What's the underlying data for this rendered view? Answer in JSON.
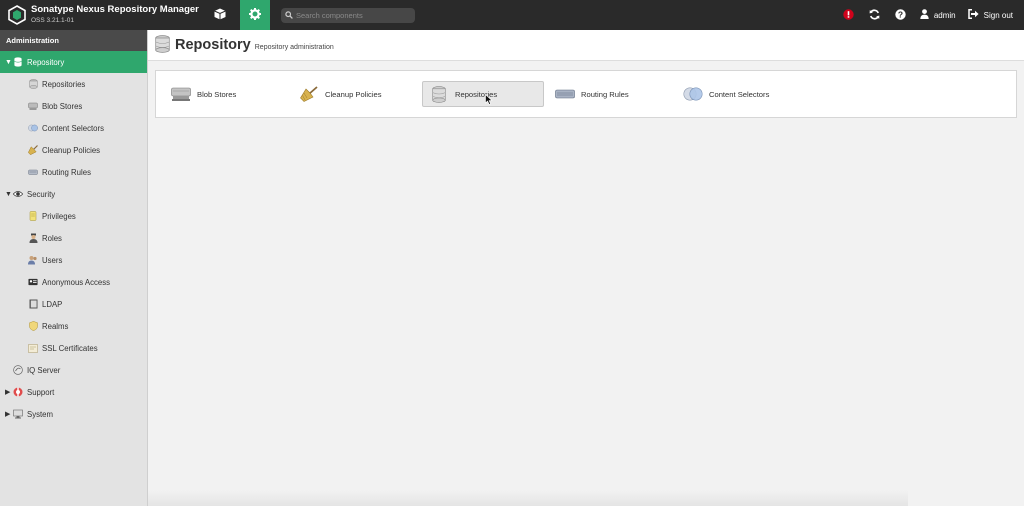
{
  "header": {
    "app_name": "Sonatype Nexus Repository Manager",
    "version": "OSS 3.21.1-01",
    "search_placeholder": "Search components",
    "user": "admin",
    "signout": "Sign out",
    "colors": {
      "bar": "#2a2a2a",
      "accent": "#2fa76d",
      "alert": "#d0021b"
    },
    "icons": [
      "logo-icon",
      "browse-cube-icon",
      "admin-gear-icon",
      "search-icon",
      "alert-icon",
      "refresh-icon",
      "help-icon",
      "user-icon",
      "signout-icon"
    ]
  },
  "sidebar": {
    "title": "Administration",
    "items": [
      {
        "label": "Repository",
        "icon": "database-icon"
      },
      {
        "label": "Repositories",
        "icon": "repositories-icon"
      },
      {
        "label": "Blob Stores",
        "icon": "blob-store-icon"
      },
      {
        "label": "Content Selectors",
        "icon": "content-selector-icon"
      },
      {
        "label": "Cleanup Policies",
        "icon": "broom-icon"
      },
      {
        "label": "Routing Rules",
        "icon": "router-icon"
      },
      {
        "label": "Security",
        "icon": "eye-icon"
      },
      {
        "label": "Privileges",
        "icon": "privileges-icon"
      },
      {
        "label": "Roles",
        "icon": "roles-icon"
      },
      {
        "label": "Users",
        "icon": "users-icon"
      },
      {
        "label": "Anonymous Access",
        "icon": "id-card-icon"
      },
      {
        "label": "LDAP",
        "icon": "ldap-book-icon"
      },
      {
        "label": "Realms",
        "icon": "realms-shield-icon"
      },
      {
        "label": "SSL Certificates",
        "icon": "certificate-icon"
      },
      {
        "label": "IQ Server",
        "icon": "iq-server-icon"
      },
      {
        "label": "Support",
        "icon": "support-icon"
      },
      {
        "label": "System",
        "icon": "system-icon"
      }
    ]
  },
  "page": {
    "title": "Repository",
    "subtitle": "Repository administration",
    "features": [
      {
        "label": "Blob Stores",
        "icon": "blob-store-icon"
      },
      {
        "label": "Cleanup Policies",
        "icon": "broom-icon"
      },
      {
        "label": "Repositories",
        "icon": "database-icon"
      },
      {
        "label": "Routing Rules",
        "icon": "router-icon"
      },
      {
        "label": "Content Selectors",
        "icon": "content-selector-icon"
      }
    ]
  }
}
